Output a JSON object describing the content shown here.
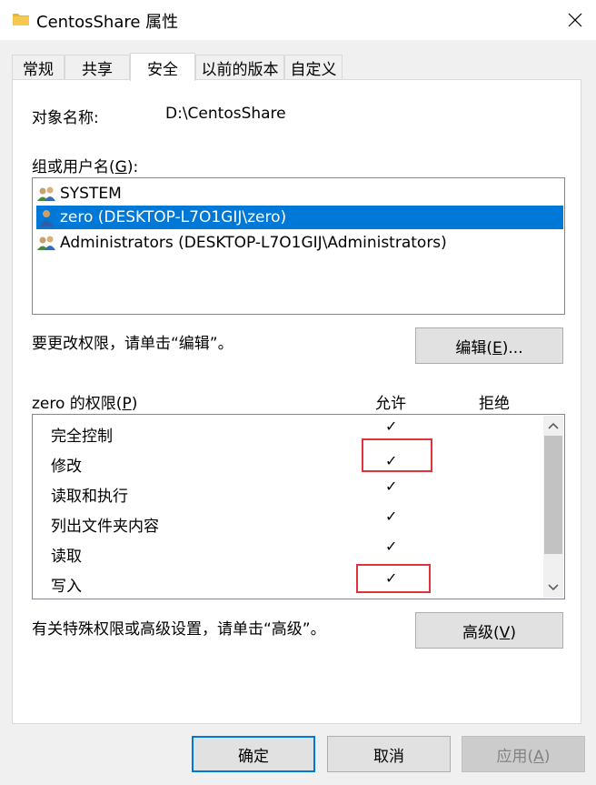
{
  "window": {
    "title": "CentosShare 属性"
  },
  "tabs": [
    "常规",
    "共享",
    "安全",
    "以前的版本",
    "自定义"
  ],
  "active_tab": "安全",
  "object": {
    "label": "对象名称:",
    "value": "D:\\CentosShare"
  },
  "groups": {
    "label": "组或用户名(G):",
    "items": [
      {
        "name": "SYSTEM",
        "selected": false
      },
      {
        "name": "zero (DESKTOP-L7O1GIJ\\zero)",
        "selected": true
      },
      {
        "name": "Administrators (DESKTOP-L7O1GIJ\\Administrators)",
        "selected": false
      }
    ]
  },
  "edit_hint": "要更改权限，请单击“编辑”。",
  "edit_button": "编辑(E)...",
  "permissions": {
    "label": "zero 的权限(P)",
    "allow_header": "允许",
    "deny_header": "拒绝",
    "rows": [
      {
        "name": "完全控制",
        "allow": "✓",
        "deny": ""
      },
      {
        "name": "修改",
        "allow": "✓",
        "deny": ""
      },
      {
        "name": "读取和执行",
        "allow": "✓",
        "deny": ""
      },
      {
        "name": "列出文件夹内容",
        "allow": "✓",
        "deny": ""
      },
      {
        "name": "读取",
        "allow": "✓",
        "deny": ""
      },
      {
        "name": "写入",
        "allow": "✓",
        "deny": ""
      }
    ]
  },
  "advanced_hint": "有关特殊权限或高级设置，请单击“高级”。",
  "advanced_button": "高级(V)",
  "footer": {
    "ok": "确定",
    "cancel": "取消",
    "apply": "应用(A)"
  },
  "colors": {
    "selection": "#0078d7",
    "highlight_box": "#e0323c",
    "primary_border": "#0078d7"
  }
}
